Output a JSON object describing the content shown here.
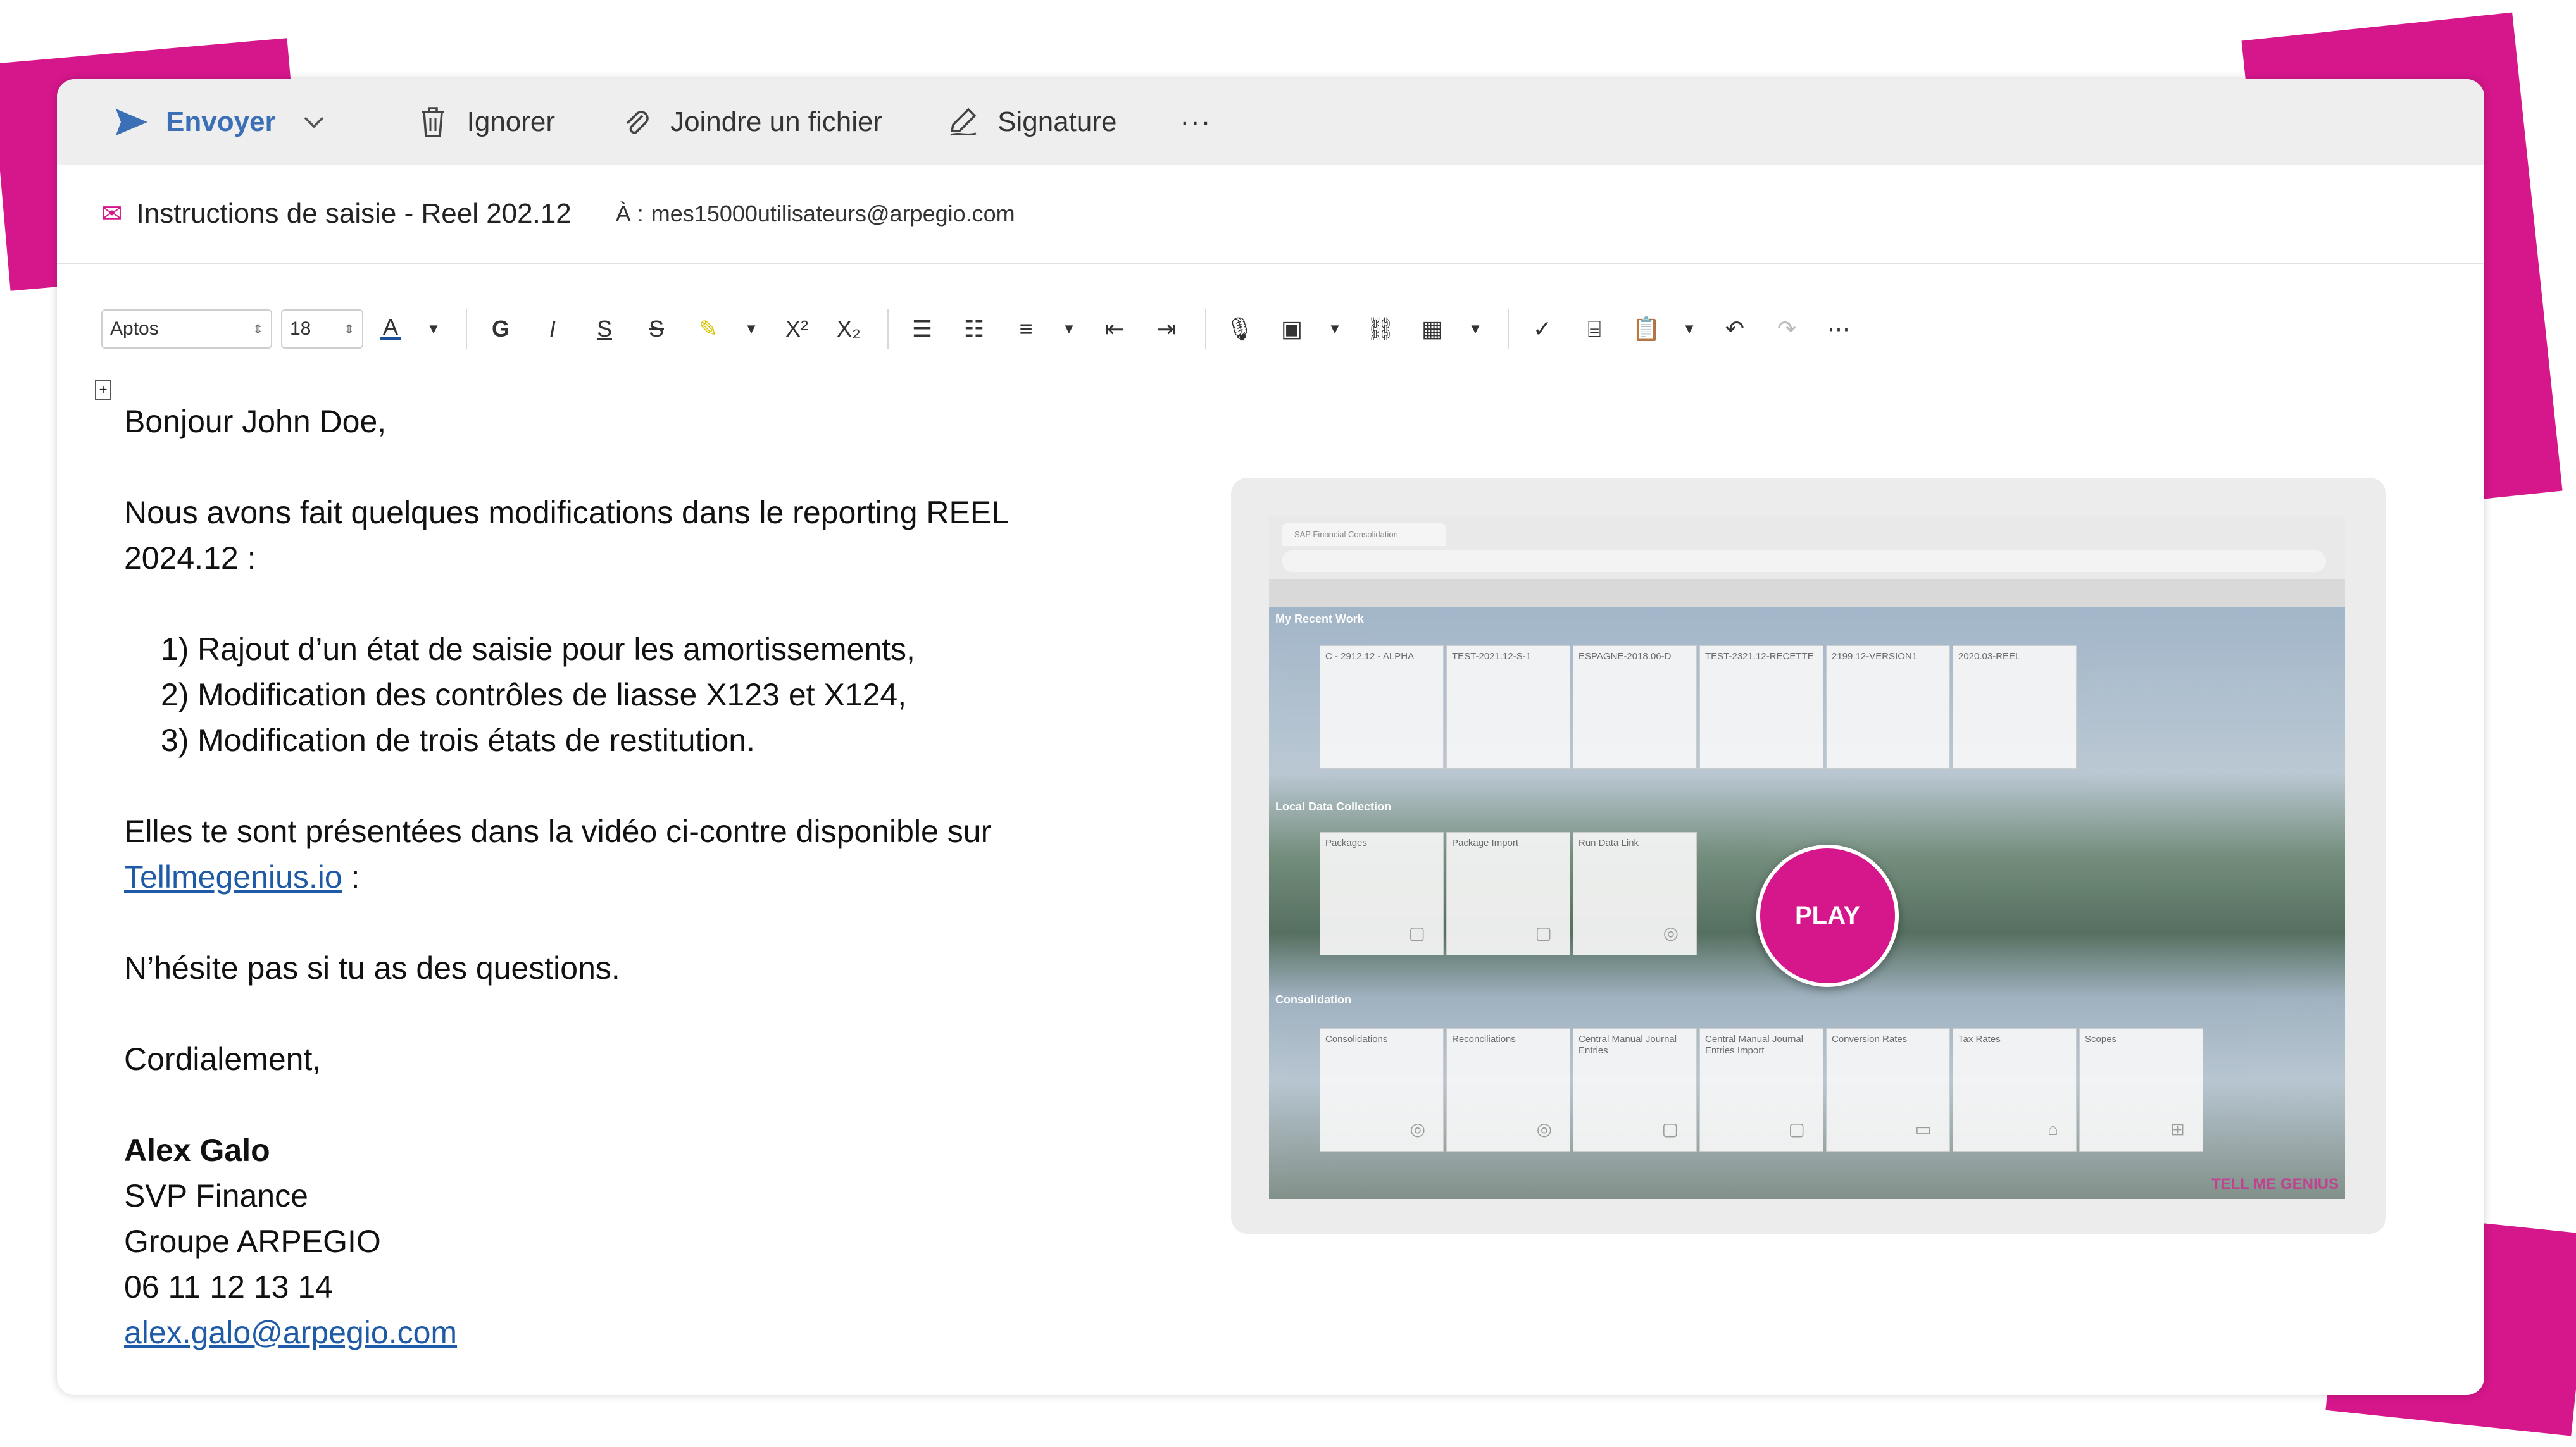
{
  "colors": {
    "accent": "#d6168b",
    "link": "#1f5aa6",
    "send": "#3b6fb6"
  },
  "actions": {
    "send_label": "Envoyer",
    "ignore_label": "Ignorer",
    "attach_label": "Joindre un fichier",
    "signature_label": "Signature",
    "more_label": "···"
  },
  "header": {
    "subject_icon": "envelope-heart-icon",
    "subject": "Instructions de saisie - Reel 202.12",
    "to_label": "À :",
    "to_value": "mes15000utilisateurs@arpegio.com"
  },
  "format": {
    "font_name": "Aptos",
    "font_size": "18"
  },
  "body": {
    "greeting": "Bonjour John Doe,",
    "intro_line1": "Nous avons fait quelques modifications dans le reporting REEL",
    "intro_line2": "2024.12 :",
    "list": [
      {
        "num": "1)",
        "text": "Rajout d’un état de saisie pour les amortissements,"
      },
      {
        "num": "2)",
        "text": "Modification des contrôles de liasse X123 et X124,"
      },
      {
        "num": "3)",
        "text": "Modification de trois états de restitution."
      }
    ],
    "video_line": "Elles te sont présentées dans la vidéo ci-contre disponible sur",
    "video_link": "Tellmegenius.io",
    "video_link_suffix": " :",
    "questions": "N’hésite pas si tu as des questions.",
    "closing": "Cordialement,"
  },
  "signature": {
    "name": "Alex Galo",
    "title": "SVP Finance",
    "company": "Groupe ARPEGIO",
    "phone": "06 11 12 13 14",
    "email": "alex.galo@arpegio.com"
  },
  "video": {
    "play_label": "PLAY",
    "browser_tab": "SAP Financial Consolidation",
    "sections": {
      "recent": "My Recent Work",
      "local": "Local Data Collection",
      "consolidation": "Consolidation"
    },
    "recent_tiles": [
      "C - 2912.12 - ALPHA",
      "TEST-2021.12-S-1",
      "ESPAGNE-2018.06-D",
      "TEST-2321.12-RECETTE",
      "2199.12-VERSION1",
      "2020.03-REEL"
    ],
    "local_tiles": [
      "Packages",
      "Package Import",
      "Run Data Link"
    ],
    "consolidation_tiles": [
      "Consolidations",
      "Reconciliations",
      "Central Manual Journal Entries",
      "Central Manual Journal Entries Import",
      "Conversion Rates",
      "Tax Rates",
      "Scopes"
    ],
    "watermark": "TELL ME GENIUS"
  }
}
